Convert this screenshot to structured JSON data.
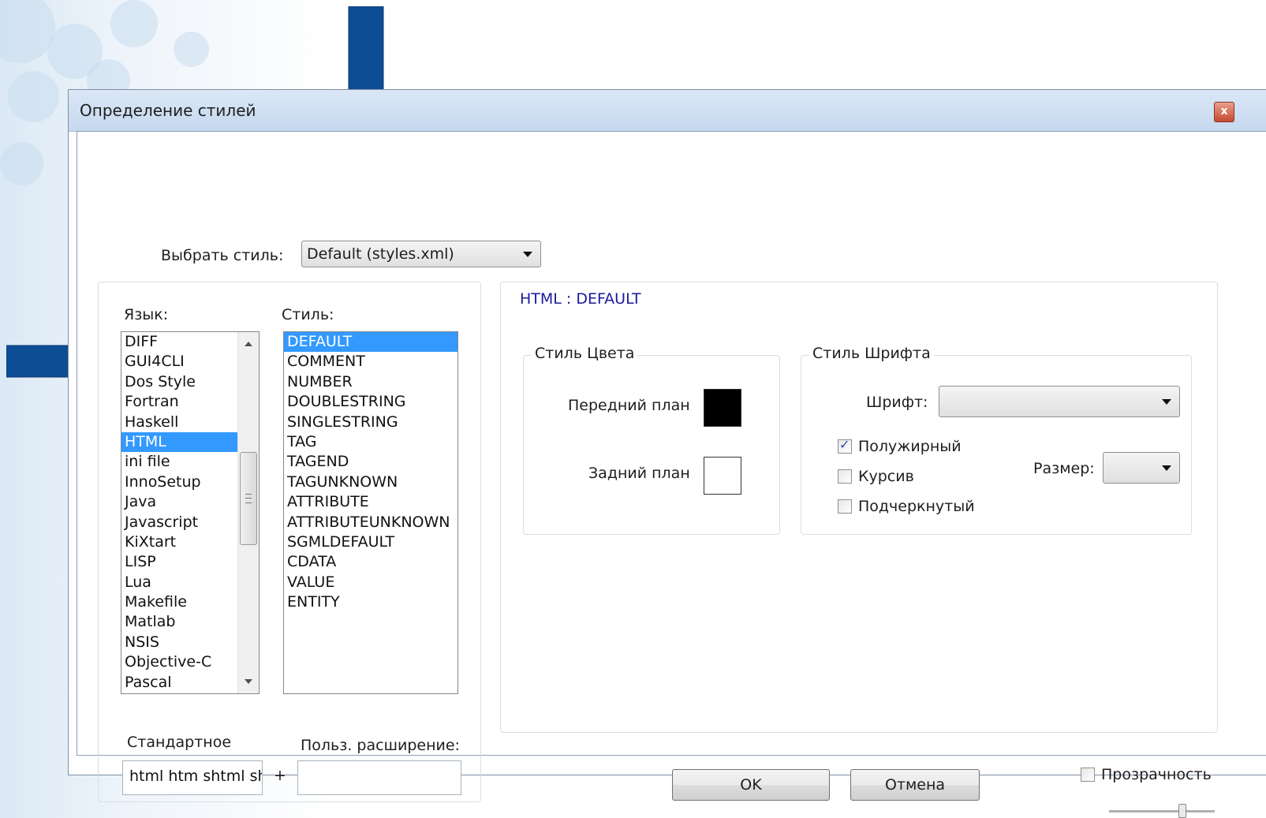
{
  "window": {
    "title": "Определение стилей",
    "close_glyph": "x"
  },
  "style_selector": {
    "label": "Выбрать стиль:",
    "value": "Default (styles.xml)"
  },
  "language": {
    "label": "Язык:",
    "items": [
      "DIFF",
      "GUI4CLI",
      "Dos Style",
      "Fortran",
      "Haskell",
      "HTML",
      "ini file",
      "InnoSetup",
      "Java",
      "Javascript",
      "KiXtart",
      "LISP",
      "Lua",
      "Makefile",
      "Matlab",
      "NSIS",
      "Objective-C",
      "Pascal"
    ],
    "selected": "HTML"
  },
  "style": {
    "label": "Стиль:",
    "items": [
      "DEFAULT",
      "COMMENT",
      "NUMBER",
      "DOUBLESTRING",
      "SINGLESTRING",
      "TAG",
      "TAGEND",
      "TAGUNKNOWN",
      "ATTRIBUTE",
      "ATTRIBUTEUNKNOWN",
      "SGMLDEFAULT",
      "CDATA",
      "VALUE",
      "ENTITY"
    ],
    "selected": "DEFAULT"
  },
  "extensions": {
    "default_label": "Стандартное",
    "default_value": "html htm shtml sh",
    "plus": "+",
    "user_label": "Польз. расширение:",
    "user_value": ""
  },
  "details": {
    "heading": "HTML : DEFAULT",
    "heading_color": "#1a1a9e",
    "color_group": {
      "legend": "Стиль Цвета",
      "foreground_label": "Передний план",
      "foreground_color": "#000000",
      "background_label": "Задний план",
      "background_color": "#ffffff"
    },
    "font_group": {
      "legend": "Стиль Шрифта",
      "font_label": "Шрифт:",
      "font_value": "",
      "bold_label": "Полужирный",
      "bold_checked": true,
      "italic_label": "Курсив",
      "italic_checked": false,
      "underline_label": "Подчеркнутый",
      "underline_checked": false,
      "size_label": "Размер:",
      "size_value": ""
    }
  },
  "buttons": {
    "ok": "OK",
    "cancel": "Отмена"
  },
  "transparency": {
    "label": "Прозрачность",
    "checked": false
  }
}
